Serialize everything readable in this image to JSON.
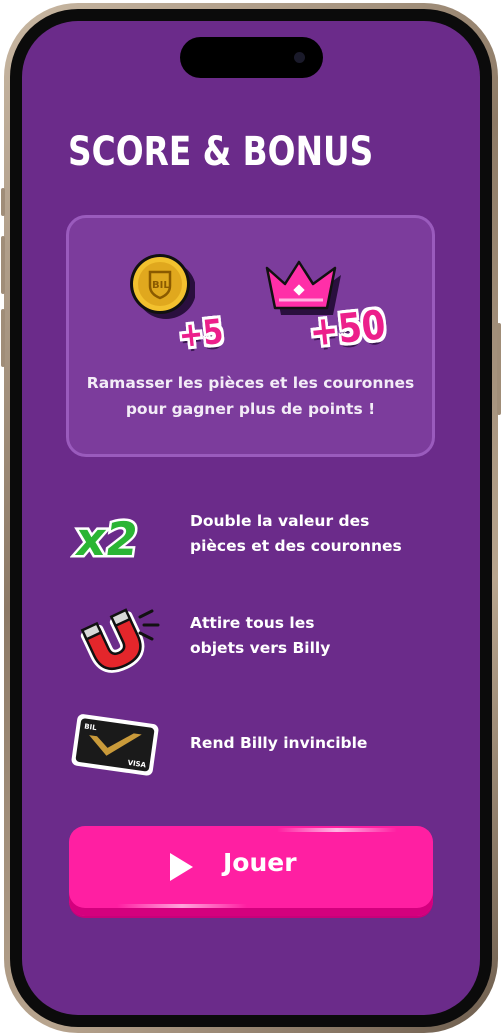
{
  "screen": {
    "title": "SCORE & BONUS"
  },
  "score_card": {
    "coin_bonus": "+5",
    "crown_bonus": "+50",
    "coin_logo_text": "BIL",
    "description_line1": "Ramasser les pièces et les couronnes",
    "description_line2": "pour gagner plus de points !"
  },
  "bonuses": [
    {
      "icon": "x2-multiplier-icon",
      "icon_text": "x2",
      "line1": "Double la valeur des",
      "line2": "pièces et des couronnes"
    },
    {
      "icon": "magnet-icon",
      "line1": "Attire tous les",
      "line2": "objets vers Billy"
    },
    {
      "icon": "card-icon",
      "card_brand": "VISA",
      "card_logo": "BIL",
      "line1": "Rend Billy invincible"
    }
  ],
  "play_button": {
    "label": "Jouer",
    "icon": "play-icon"
  },
  "colors": {
    "background": "#6b2b8a",
    "card": "#7c3c9c",
    "accent_pink": "#ff1fa2",
    "x2_green": "#2bb534",
    "coin_gold": "#e0a81e"
  }
}
